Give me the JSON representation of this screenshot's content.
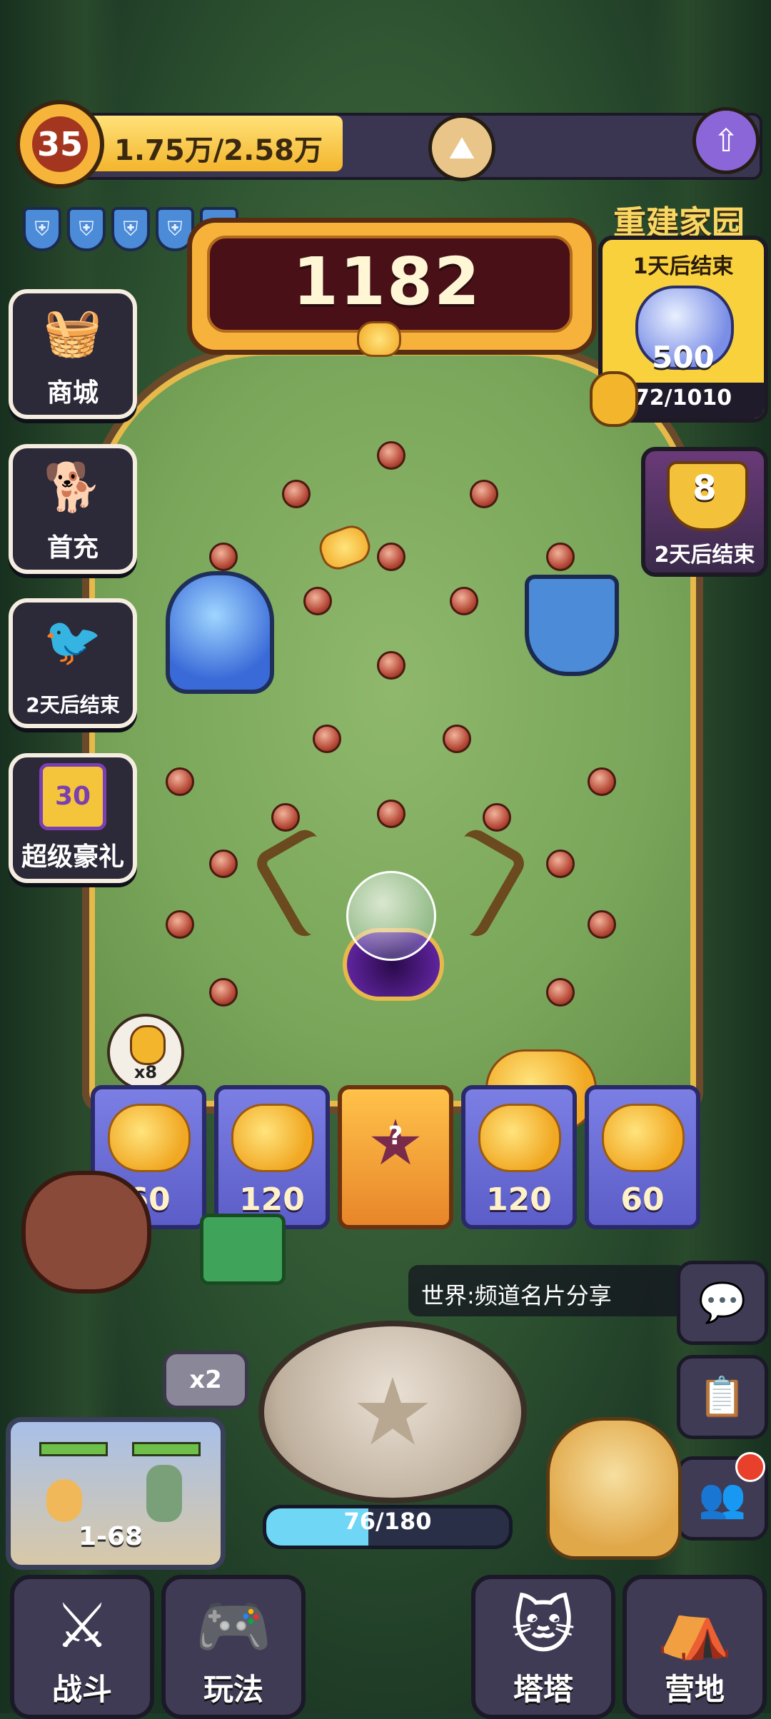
{
  "top": {
    "level": "35",
    "xp_text": "1.75万/2.58万"
  },
  "scoreboard": {
    "score": "1182"
  },
  "shields_count": 5,
  "left_menu": [
    {
      "label": "商城",
      "icon": "shopping-basket-icon"
    },
    {
      "label": "首充",
      "icon": "dog-character-icon"
    },
    {
      "label": "2天后结束",
      "icon": "bird-character-icon"
    },
    {
      "label": "超级豪礼",
      "icon": "gift-box-30-icon",
      "badge": "30"
    }
  ],
  "event_rebuild": {
    "title": "重建家园",
    "subtitle": "1天后结束",
    "reward_amount": "500",
    "progress_text": "72/1010",
    "progress": 0.071
  },
  "event_trophy": {
    "number": "8",
    "label": "2天后结束"
  },
  "bins": [
    {
      "value": "60"
    },
    {
      "value": "120"
    },
    {
      "value": "?"
    },
    {
      "value": "120"
    },
    {
      "value": "60"
    }
  ],
  "drop_marker": {
    "count": "x8"
  },
  "chat": {
    "text": "世界:频道名片分享"
  },
  "multiplier": {
    "label": "x2"
  },
  "stage": {
    "label": "1-68"
  },
  "energy": {
    "text": "76/180",
    "progress": 0.422
  },
  "nav": [
    {
      "label": "战斗",
      "icon": "crossed-swords-icon"
    },
    {
      "label": "玩法",
      "icon": "gamepad-icon"
    },
    {
      "label": "塔塔",
      "icon": "cat-character-icon"
    },
    {
      "label": "营地",
      "icon": "tent-icon"
    }
  ],
  "colors": {
    "xp_fill": "#f3b52c",
    "board": "#f7b23c",
    "bin": "#6c6ed6",
    "special_bin": "#f4a52c",
    "energy_fill": "#6fd6f5"
  }
}
